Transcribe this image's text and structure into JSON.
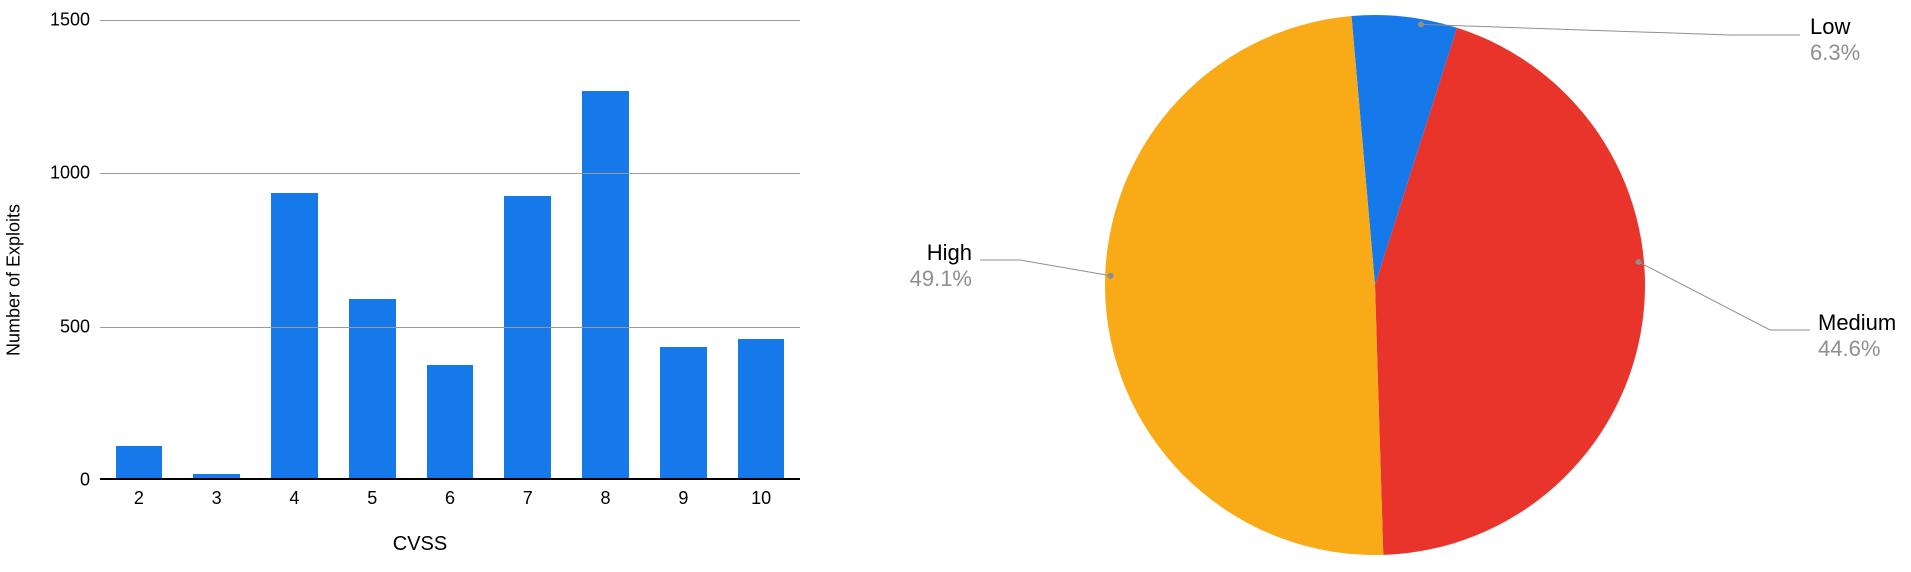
{
  "chart_data": [
    {
      "type": "bar",
      "categories": [
        "2",
        "3",
        "4",
        "5",
        "6",
        "7",
        "8",
        "9",
        "10"
      ],
      "values": [
        110,
        20,
        935,
        590,
        375,
        925,
        1270,
        435,
        460
      ],
      "xlabel": "CVSS",
      "ylabel": "Number of Exploits",
      "ylim": [
        0,
        1500
      ],
      "yticks": [
        0,
        500,
        1000,
        1500
      ],
      "color": "#1679ea"
    },
    {
      "type": "pie",
      "series": [
        {
          "name": "Low",
          "value": 6.3,
          "color": "#1679ea",
          "label_pct": "6.3%"
        },
        {
          "name": "Medium",
          "value": 44.6,
          "color": "#e9342c",
          "label_pct": "44.6%"
        },
        {
          "name": "High",
          "value": 49.1,
          "color": "#f8ab17",
          "label_pct": "49.1%"
        }
      ]
    }
  ]
}
